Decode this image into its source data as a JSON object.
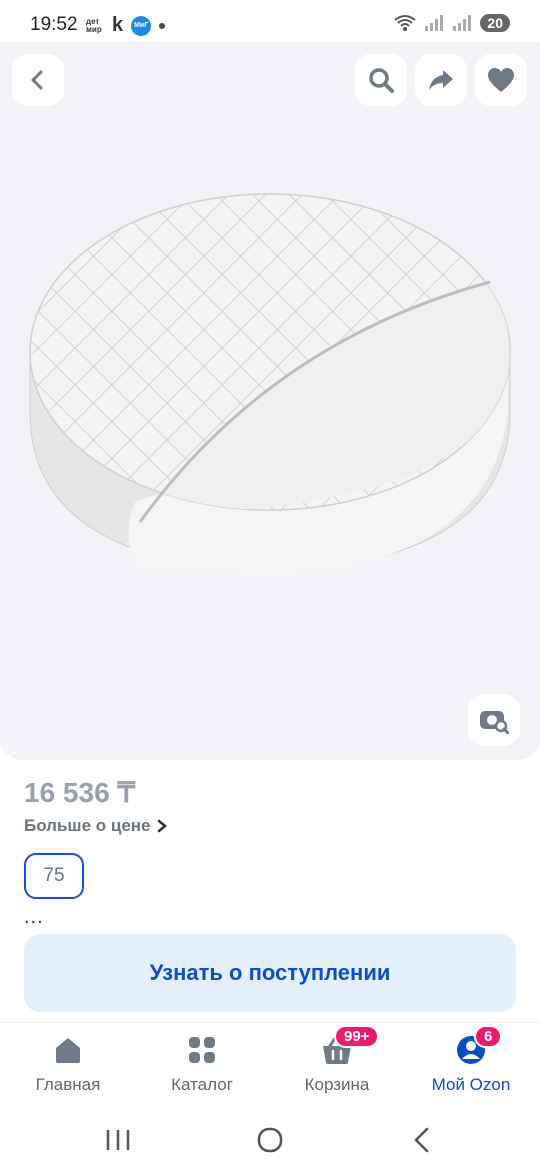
{
  "status_bar": {
    "time": "19:52",
    "apps": [
      "дет мир",
      "k",
      "МиГ"
    ],
    "battery": "20"
  },
  "header": {
    "back_icon": "chevron-left-icon",
    "search_icon": "search-icon",
    "share_icon": "share-icon",
    "favorite_icon": "heart-icon"
  },
  "product": {
    "price": "16 536 ₸",
    "more_about_price": "Больше о цене",
    "size_option": "75",
    "ellipsis": "...",
    "notify_button": "Узнать о поступлении"
  },
  "bottom_nav": {
    "items": [
      {
        "label": "Главная",
        "icon": "home-icon"
      },
      {
        "label": "Каталог",
        "icon": "catalog-icon"
      },
      {
        "label": "Корзина",
        "icon": "cart-icon",
        "badge": "99+"
      },
      {
        "label": "Мой Ozon",
        "icon": "profile-icon",
        "badge": "6"
      }
    ]
  },
  "colors": {
    "accent": "#0a4fc4",
    "badge": "#ee1a6b",
    "gallery_bg": "#f2f3f7",
    "notify_bg": "#e4f0fc"
  }
}
